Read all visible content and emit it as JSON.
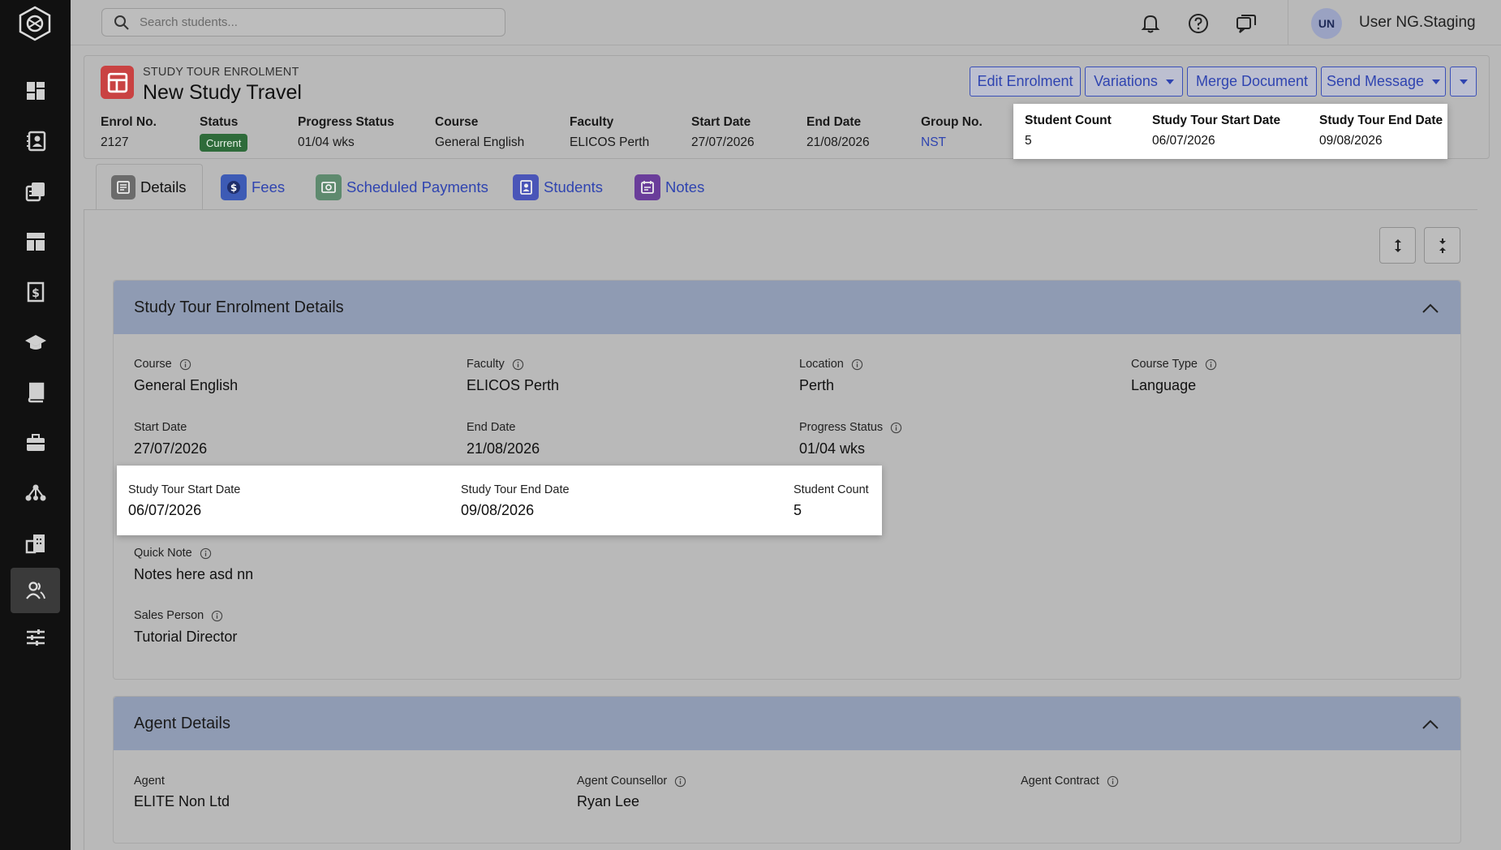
{
  "search": {
    "placeholder": "Search students..."
  },
  "user": {
    "initials": "UN",
    "name": "User NG.Staging"
  },
  "header": {
    "kicker": "STUDY TOUR ENROLMENT",
    "title": "New Study Travel",
    "buttons": {
      "edit": "Edit Enrolment",
      "variations": "Variations",
      "merge": "Merge Document",
      "send": "Send Message"
    },
    "meta": {
      "enrol_no_label": "Enrol No.",
      "enrol_no": "2127",
      "status_label": "Status",
      "status": "Current",
      "progress_label": "Progress Status",
      "progress": "01/04 wks",
      "course_label": "Course",
      "course": "General English",
      "faculty_label": "Faculty",
      "faculty": "ELICOS Perth",
      "start_label": "Start Date",
      "start": "27/07/2026",
      "end_label": "End Date",
      "end": "21/08/2026",
      "group_label": "Group No.",
      "group": "NST"
    },
    "popover": {
      "student_count_label": "Student Count",
      "student_count": "5",
      "tour_start_label": "Study Tour Start Date",
      "tour_start": "06/07/2026",
      "tour_end_label": "Study Tour End Date",
      "tour_end": "09/08/2026"
    }
  },
  "tabs": {
    "details": "Details",
    "fees": "Fees",
    "scheduled": "Scheduled Payments",
    "students": "Students",
    "notes": "Notes"
  },
  "enrolment_panel": {
    "title": "Study Tour Enrolment Details",
    "course_label": "Course",
    "course": "General English",
    "faculty_label": "Faculty",
    "faculty": "ELICOS Perth",
    "location_label": "Location",
    "location": "Perth",
    "course_type_label": "Course Type",
    "course_type": "Language",
    "start_label": "Start Date",
    "start": "27/07/2026",
    "end_label": "End Date",
    "end": "21/08/2026",
    "progress_label": "Progress Status",
    "progress": "01/04 wks",
    "quick_note_label": "Quick Note",
    "quick_note": "Notes here asd nn",
    "sales_label": "Sales Person",
    "sales": "Tutorial Director",
    "popover": {
      "tour_start_label": "Study Tour Start Date",
      "tour_start": "06/07/2026",
      "tour_end_label": "Study Tour End Date",
      "tour_end": "09/08/2026",
      "student_count_label": "Student Count",
      "student_count": "5"
    }
  },
  "agent_panel": {
    "title": "Agent Details",
    "agent_label": "Agent",
    "agent": "ELITE Non Ltd",
    "counsellor_label": "Agent Counsellor",
    "counsellor": "Ryan Lee",
    "contract_label": "Agent Contract"
  },
  "colors": {
    "accent": "#2f44b0",
    "status_badge": "#2e6b3a",
    "panel_header": "#8f9bb3",
    "sidebar": "#111111"
  }
}
